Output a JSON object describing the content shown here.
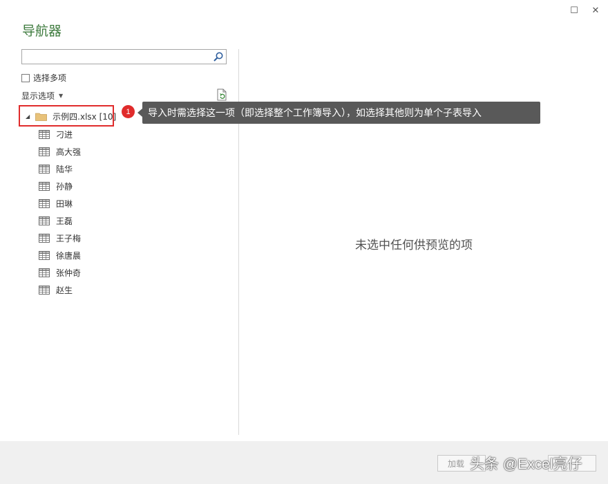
{
  "window": {
    "title": "导航器",
    "maximize_glyph": "☐",
    "close_glyph": "✕"
  },
  "left_panel": {
    "search": {
      "value": "",
      "placeholder": ""
    },
    "select_multiple_label": "选择多项",
    "display_options_label": "显示选项",
    "tree": {
      "root_label": "示例四.xlsx [10]",
      "items": [
        "刁进",
        "高大强",
        "陆华",
        "孙静",
        "田琳",
        "王磊",
        "王子梅",
        "徐唐晨",
        "张仲奇",
        "赵生"
      ]
    }
  },
  "annotation": {
    "number": "1",
    "text": "导入时需选择这一项（即选择整个工作簿导入），如选择其他则为单个子表导入"
  },
  "preview": {
    "empty_message": "未选中任何供预览的项"
  },
  "footer": {
    "load_label": "加载",
    "watermark": "头条 @Excel亮仔"
  },
  "colors": {
    "title_green": "#3c7a3c",
    "highlight_red": "#e02b2b",
    "callout_bg": "#595959"
  }
}
